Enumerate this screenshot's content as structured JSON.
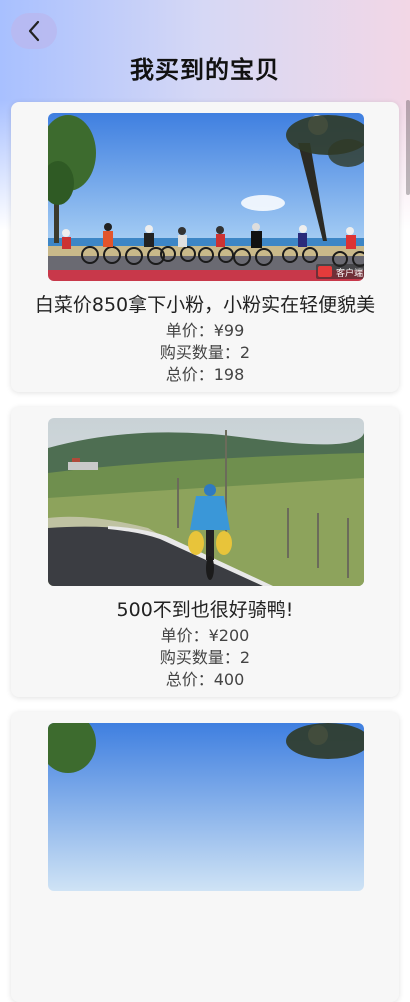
{
  "header": {
    "title": "我买到的宝贝"
  },
  "products": [
    {
      "name": "白菜价850拿下小粉，小粉实在轻便貌美",
      "unit_price": "单价：¥99",
      "quantity": "购买数量：2",
      "total": "总价：198",
      "image_icon": "cyclists-seaside-photo",
      "watermark": "客户端"
    },
    {
      "name": "500不到也很好骑鸭!",
      "unit_price": "单价：¥200",
      "quantity": "购买数量：2",
      "total": "总价：400",
      "image_icon": "cyclist-mountain-road-photo"
    },
    {
      "image_icon": "cyclists-seaside-photo"
    }
  ],
  "colors": {
    "header_gradient_start": "#a8c0ff",
    "header_gradient_end": "#f2d7e6",
    "card_bg": "#f7f7f7",
    "back_button_bg": "#b8b8f0"
  }
}
